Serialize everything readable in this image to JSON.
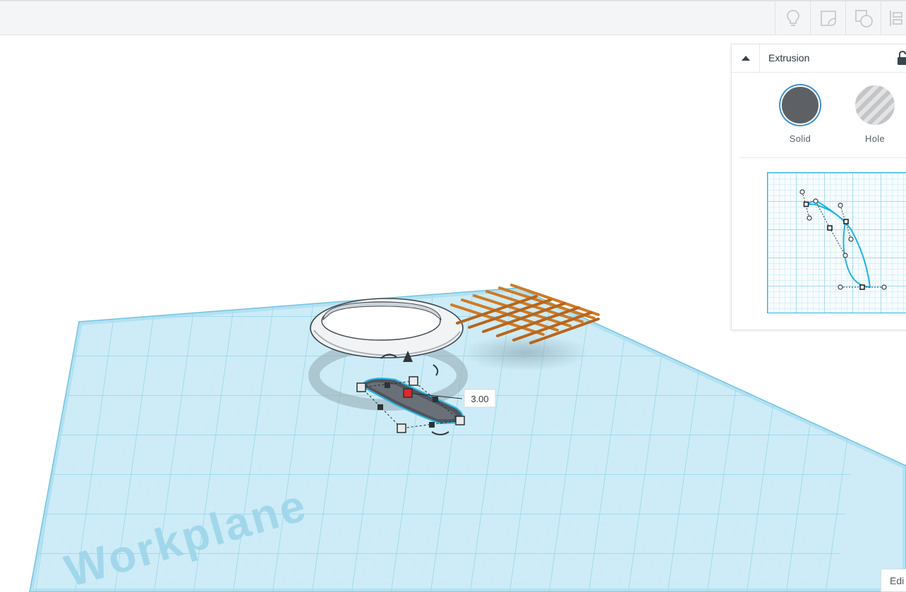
{
  "toolbar": {
    "buttons": [
      {
        "icon": "lightbulb-icon"
      },
      {
        "icon": "note-icon"
      },
      {
        "icon": "shape-group-icon"
      },
      {
        "icon": "align-icon"
      }
    ]
  },
  "viewport": {
    "workplane_label": "Workplane",
    "height_readout": "3.00"
  },
  "inspector": {
    "title": "Extrusion",
    "solid_label": "Solid",
    "hole_label": "Hole",
    "solid_color": "#5d6166",
    "selected_option": "Solid"
  },
  "edit_tab": {
    "label": "Edi"
  }
}
